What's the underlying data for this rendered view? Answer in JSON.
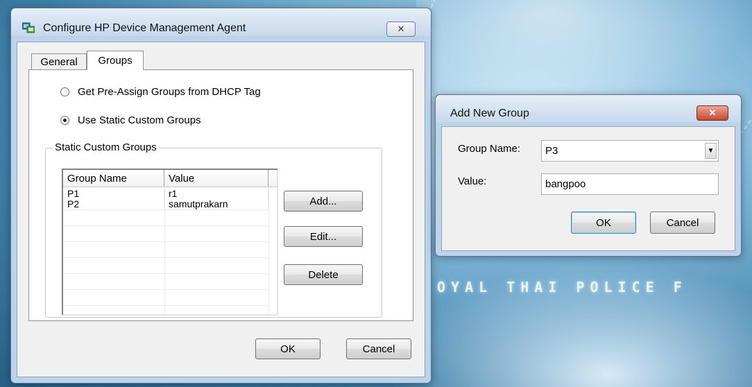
{
  "desktop": {
    "wallpaper_text": "OYAL THAI POLICE F"
  },
  "main_dialog": {
    "title": "Configure HP Device Management Agent",
    "close_symbol": "✕",
    "tabs": [
      {
        "label": "General",
        "active": false
      },
      {
        "label": "Groups",
        "active": true
      }
    ],
    "radio_options": [
      {
        "label": "Get Pre-Assign Groups from DHCP Tag",
        "checked": false
      },
      {
        "label": "Use Static Custom Groups",
        "checked": true
      }
    ],
    "groupbox_label": "Static Custom Groups",
    "list": {
      "columns": [
        "Group Name",
        "Value"
      ],
      "rows": [
        {
          "group_name": "P1",
          "value": "r1"
        },
        {
          "group_name": "P2",
          "value": "samutprakarn"
        }
      ]
    },
    "buttons": {
      "add": "Add...",
      "edit": "Edit...",
      "delete": "Delete",
      "ok": "OK",
      "cancel": "Cancel"
    }
  },
  "add_dialog": {
    "title": "Add New Group",
    "close_symbol": "✕",
    "group_name_label": "Group Name:",
    "group_name_value": "P3",
    "value_label": "Value:",
    "value_value": "bangpoo",
    "ok": "OK",
    "cancel": "Cancel"
  }
}
